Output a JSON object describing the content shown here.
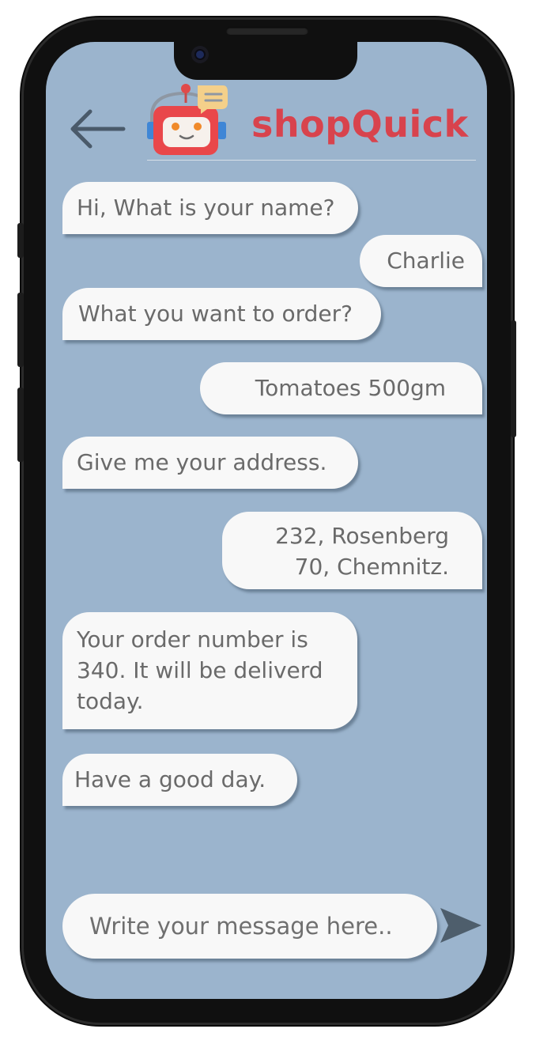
{
  "header": {
    "title": "shopQuick",
    "back_icon": "arrow-left-icon",
    "logo_icon": "chat-robot-icon"
  },
  "messages": [
    {
      "sender": "bot",
      "text": "Hi, What is your name?"
    },
    {
      "sender": "user",
      "text": "Charlie"
    },
    {
      "sender": "bot",
      "text": "What you want to order?"
    },
    {
      "sender": "user",
      "text": "Tomatoes 500gm"
    },
    {
      "sender": "bot",
      "text": "Give me your address."
    },
    {
      "sender": "user",
      "text": "232, Rosenberg\n70, Chemnitz."
    },
    {
      "sender": "bot",
      "text": "Your order number is\n340. It will be deliverd\ntoday."
    },
    {
      "sender": "bot",
      "text": "Have a good day."
    }
  ],
  "composer": {
    "placeholder": "Write your message here..",
    "send_icon": "send-icon"
  },
  "colors": {
    "screen_background": "#9bb4cd",
    "bubble": "#f8f8f8",
    "bubble_text": "#6a6a6a",
    "brand": "#d8434d",
    "icon": "#4a5a6a"
  }
}
